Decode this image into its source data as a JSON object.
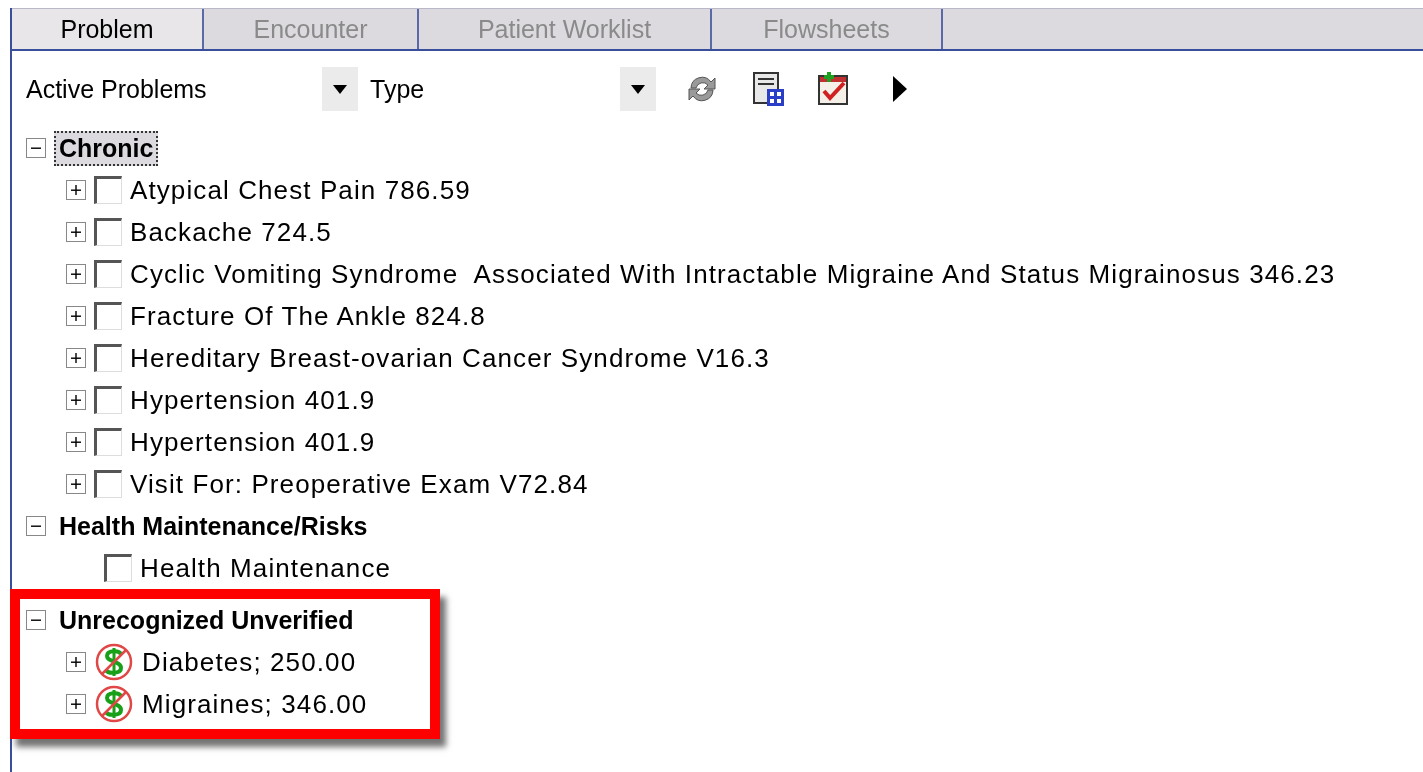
{
  "tabs": [
    {
      "label": "Problem",
      "selected": true
    },
    {
      "label": "Encounter",
      "selected": false
    },
    {
      "label": "Patient Worklist",
      "selected": false
    },
    {
      "label": "Flowsheets",
      "selected": false
    }
  ],
  "toolbar": {
    "filter": {
      "value": "Active Problems"
    },
    "sort": {
      "value": "Type"
    }
  },
  "tree": [
    {
      "label": "Chronic",
      "expanded": true,
      "selected": true,
      "highlighted": false,
      "children": [
        {
          "kind": "checkbox",
          "label": "Atypical Chest Pain 786.59",
          "expanded": false,
          "checked": false
        },
        {
          "kind": "checkbox",
          "label": "Backache 724.5",
          "expanded": false,
          "checked": false
        },
        {
          "kind": "checkbox",
          "label": "Cyclic Vomiting Syndrome  Associated With Intractable Migraine And Status Migrainosus 346.23",
          "expanded": false,
          "checked": false
        },
        {
          "kind": "checkbox",
          "label": "Fracture Of The Ankle 824.8",
          "expanded": false,
          "checked": false
        },
        {
          "kind": "checkbox",
          "label": "Hereditary Breast-ovarian Cancer Syndrome V16.3",
          "expanded": false,
          "checked": false
        },
        {
          "kind": "checkbox",
          "label": "Hypertension 401.9",
          "expanded": false,
          "checked": false
        },
        {
          "kind": "checkbox",
          "label": "Hypertension 401.9",
          "expanded": false,
          "checked": false
        },
        {
          "kind": "checkbox",
          "label": "Visit For: Preoperative Exam V72.84",
          "expanded": false,
          "checked": false
        }
      ]
    },
    {
      "label": "Health Maintenance/Risks",
      "expanded": true,
      "selected": false,
      "highlighted": false,
      "children": [
        {
          "kind": "checkbox",
          "label": "Health Maintenance",
          "checked": false
        }
      ]
    },
    {
      "label": "Unrecognized Unverified",
      "expanded": true,
      "selected": false,
      "highlighted": true,
      "children": [
        {
          "kind": "unbillable",
          "label": "Diabetes; 250.00",
          "expanded": false
        },
        {
          "kind": "unbillable",
          "label": "Migraines; 346.00",
          "expanded": false
        }
      ]
    }
  ]
}
